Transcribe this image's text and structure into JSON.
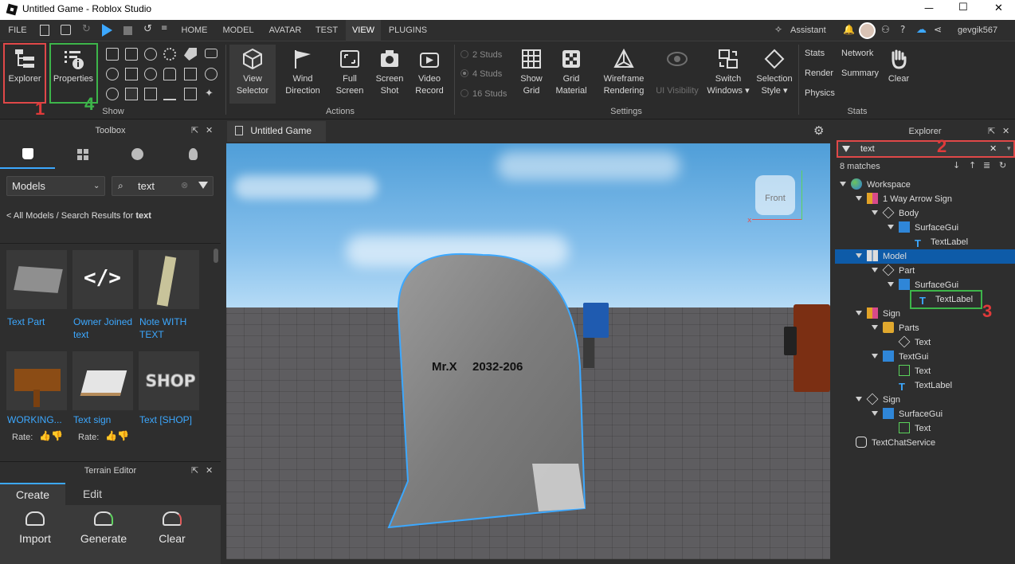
{
  "window": {
    "title": "Untitled Game - Roblox Studio",
    "minimize": "—",
    "maximize": "☐",
    "close": "✕"
  },
  "menu": {
    "items": [
      "FILE",
      "HOME",
      "MODEL",
      "AVATAR",
      "TEST",
      "VIEW",
      "PLUGINS"
    ],
    "active": "VIEW",
    "assistant": "Assistant",
    "username": "gevgik567"
  },
  "ribbon": {
    "explorer": "Explorer",
    "properties": "Properties",
    "show_group": "Show",
    "view_selector": [
      "View",
      "Selector"
    ],
    "wind_direction": [
      "Wind",
      "Direction"
    ],
    "full_screen": [
      "Full",
      "Screen"
    ],
    "screen_shot": [
      "Screen",
      "Shot"
    ],
    "video_record": [
      "Video",
      "Record"
    ],
    "actions_group": "Actions",
    "studs": [
      "2 Studs",
      "4 Studs",
      "16 Studs"
    ],
    "show_grid": [
      "Show",
      "Grid"
    ],
    "grid_material": [
      "Grid",
      "Material"
    ],
    "wireframe": [
      "Wireframe",
      "Rendering"
    ],
    "ui_visibility": "UI Visibility",
    "switch_windows": [
      "Switch",
      "Windows ▾"
    ],
    "selection_style": [
      "Selection",
      "Style ▾"
    ],
    "settings_group": "Settings",
    "stats": [
      "Stats",
      "Render",
      "Physics"
    ],
    "stats2": [
      "Network",
      "Summary"
    ],
    "clear": "Clear",
    "stats_group": "Stats"
  },
  "toolbox": {
    "title": "Toolbox",
    "category": "Models",
    "search_value": "text",
    "breadcrumb_prefix": "< All Models / Search Results for ",
    "breadcrumb_term": "text",
    "cards": [
      {
        "label": "Text Part"
      },
      {
        "label": "Owner Joined text"
      },
      {
        "label": "Note WITH TEXT"
      },
      {
        "label": "WORKING..."
      },
      {
        "label": "Text sign"
      },
      {
        "label": "Text [SHOP]"
      }
    ],
    "rate_label": "Rate:"
  },
  "terrain": {
    "title": "Terrain Editor",
    "tabs": [
      "Create",
      "Edit"
    ],
    "tools": [
      "Import",
      "Generate",
      "Clear"
    ]
  },
  "viewport": {
    "tab_label": "Untitled Game",
    "gravestone_text_name": "Mr.X",
    "gravestone_text_date": "2032-206",
    "cube_label": "Front"
  },
  "explorer": {
    "title": "Explorer",
    "filter_value": "text",
    "matches": "8 matches",
    "nodes": [
      "Workspace",
      "1 Way Arrow Sign",
      "Body",
      "SurfaceGui",
      "TextLabel",
      "Model",
      "Part",
      "SurfaceGui",
      "TextLabel",
      "Sign",
      "Parts",
      "Text",
      "TextGui",
      "Text",
      "TextLabel",
      "Sign",
      "SurfaceGui",
      "Text",
      "TextChatService"
    ]
  },
  "annotations": {
    "n1": "1",
    "n2": "2",
    "n3": "3",
    "n4": "4"
  },
  "colors": {
    "accent": "#3ca8ff",
    "selection": "#0e5ba8",
    "red_annotation": "#e04848",
    "green_annotation": "#3db54a"
  }
}
